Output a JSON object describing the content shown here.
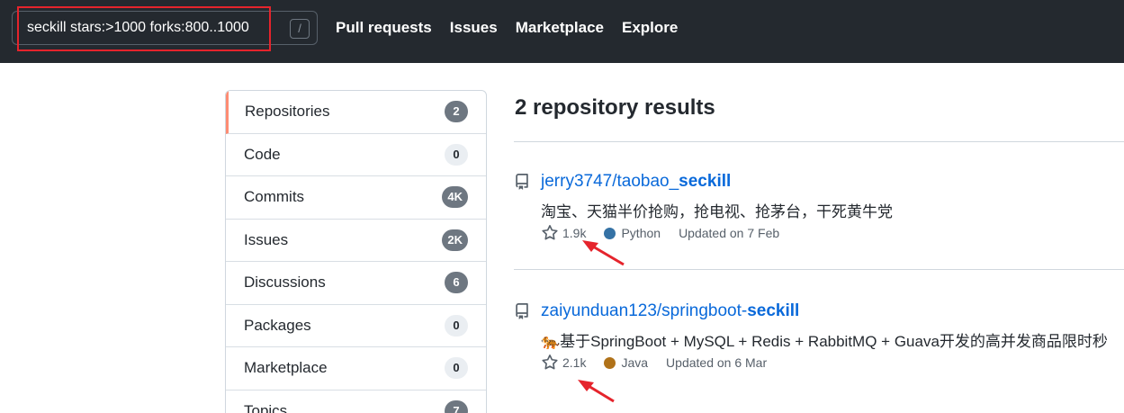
{
  "search": {
    "value": "seckill stars:>1000 forks:800..1000",
    "shortcut": "/"
  },
  "nav": {
    "items": [
      "Pull requests",
      "Issues",
      "Marketplace",
      "Explore"
    ]
  },
  "sidebar": {
    "items": [
      {
        "label": "Repositories",
        "count": "2"
      },
      {
        "label": "Code",
        "count": "0"
      },
      {
        "label": "Commits",
        "count": "4K"
      },
      {
        "label": "Issues",
        "count": "2K"
      },
      {
        "label": "Discussions",
        "count": "6"
      },
      {
        "label": "Packages",
        "count": "0"
      },
      {
        "label": "Marketplace",
        "count": "0"
      },
      {
        "label": "Topics",
        "count": "7"
      }
    ]
  },
  "results": {
    "title": "2 repository results",
    "repos": [
      {
        "owner_prefix": "jerry3747/taobao_",
        "highlight": "seckill",
        "description": "淘宝、天猫半价抢购，抢电视、抢茅台，干死黄牛党",
        "stars": "1.9k",
        "language": "Python",
        "language_color": "#3572A5",
        "updated": "Updated on 7 Feb"
      },
      {
        "owner_prefix": "zaiyunduan123/springboot-",
        "highlight": "seckill",
        "emoji": "🐅",
        "description": "基于SpringBoot + MySQL + Redis + RabbitMQ + Guava开发的高并发商品限时秒",
        "stars": "2.1k",
        "language": "Java",
        "language_color": "#b07219",
        "updated": "Updated on 6 Mar"
      }
    ]
  },
  "colors": {
    "header_bg": "#24292f",
    "link": "#0969da",
    "annotation_red": "#e5242c",
    "selected_tab": "#fd8c73"
  }
}
